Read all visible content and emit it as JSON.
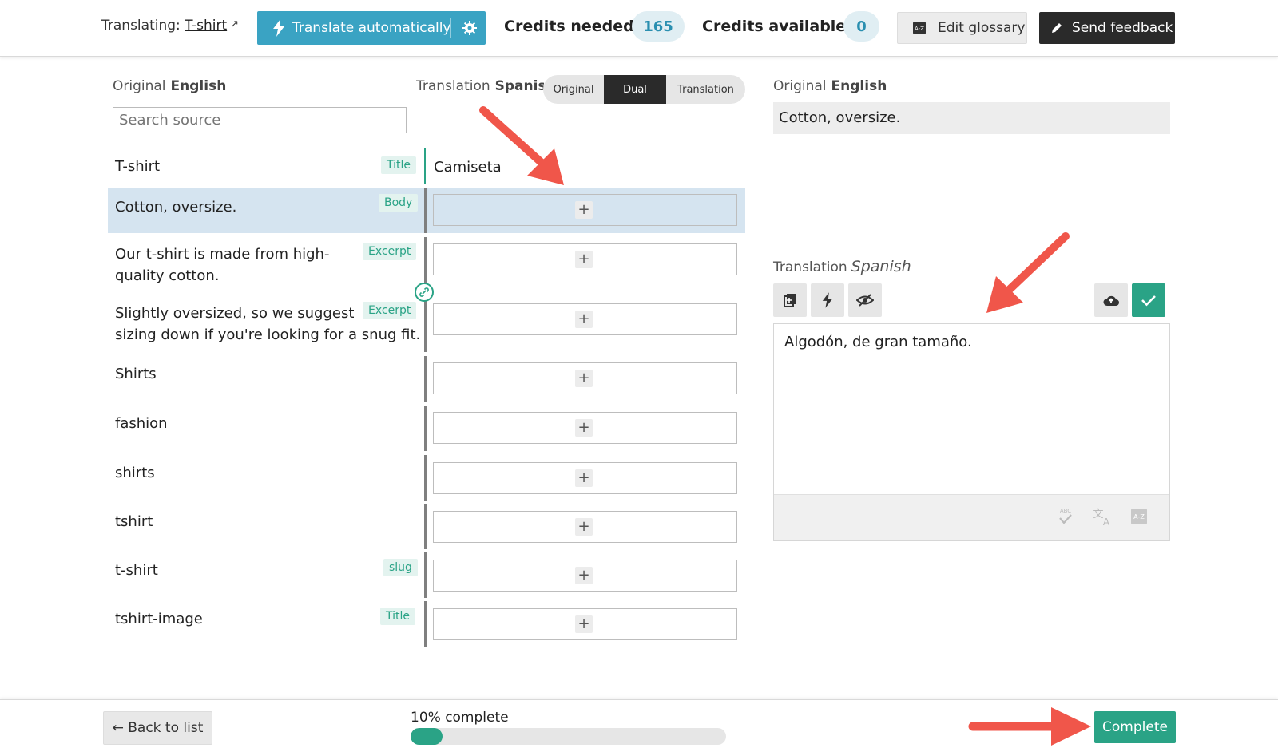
{
  "header": {
    "translating_label": "Translating:",
    "translating_link": "T-shirt",
    "translate_button": "Translate automatically",
    "credits_needed_label": "Credits needed",
    "credits_needed_value": "165",
    "credits_available_label": "Credits available",
    "credits_available_value": "0",
    "glossary_button": "Edit glossary",
    "feedback_button": "Send feedback"
  },
  "columns": {
    "original_label": "Original",
    "original_lang": "English",
    "translation_label": "Translation",
    "translation_lang": "Spanish",
    "search_placeholder": "Search source",
    "view_modes": [
      "Original",
      "Dual",
      "Translation"
    ],
    "active_view": "Dual"
  },
  "rows": [
    {
      "source": "T-shirt",
      "tag": "Title",
      "translation": "Camiseta"
    },
    {
      "source": "Cotton, oversize.",
      "tag": "Body",
      "translation": ""
    },
    {
      "source_line1": "Our t-shirt is made from high-",
      "source_line2": "quality cotton.",
      "tag": "Excerpt",
      "translation": ""
    },
    {
      "source_line1": "Slightly oversized, so we suggest",
      "source_line2": "sizing down if you're looking for a snug fit.",
      "tag": "Excerpt",
      "translation": ""
    },
    {
      "source": "Shirts",
      "tag": "",
      "translation": ""
    },
    {
      "source": "fashion",
      "tag": "",
      "translation": ""
    },
    {
      "source": "shirts",
      "tag": "",
      "translation": ""
    },
    {
      "source": "tshirt",
      "tag": "",
      "translation": ""
    },
    {
      "source": "t-shirt",
      "tag": "slug",
      "translation": ""
    },
    {
      "source": "tshirt-image",
      "tag": "Title",
      "translation": ""
    }
  ],
  "add_symbol": "+",
  "detail": {
    "original_label": "Original",
    "original_lang": "English",
    "original_text": "Cotton, oversize.",
    "translation_label": "Translation",
    "translation_lang": "Spanish",
    "translation_text": "Algodón, de gran tamaño."
  },
  "footer": {
    "back_button": "← Back to list",
    "progress_label": "10% complete",
    "progress_fraction": 0.1,
    "complete_button": "Complete"
  },
  "colors": {
    "accent_blue": "#3aa3c3",
    "accent_green": "#2aa386",
    "selected_row": "#d5e4f0",
    "annotation_arrow": "#f0564a"
  },
  "icons": [
    "lightning-icon",
    "gear-icon",
    "external-link-icon",
    "glossary-az-icon",
    "pencil-icon",
    "link-icon",
    "copy-icon",
    "eye-slash-icon",
    "cloud-upload-icon",
    "check-icon",
    "spellcheck-icon",
    "translate-icon"
  ]
}
